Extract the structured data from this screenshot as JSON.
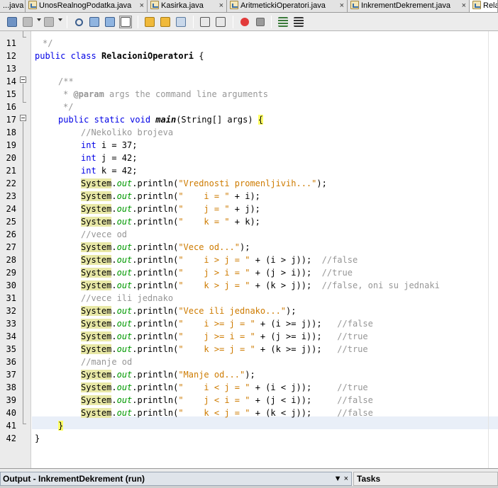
{
  "tabs": [
    {
      "label": "...java",
      "active": false
    },
    {
      "label": "UnosRealnogPodatka.java",
      "active": false
    },
    {
      "label": "Kasirka.java",
      "active": false
    },
    {
      "label": "AritmetickiOperatori.java",
      "active": false
    },
    {
      "label": "InkrementDekrement.java",
      "active": false
    },
    {
      "label": "Rela",
      "active": true
    }
  ],
  "tab_close_glyph": "×",
  "line_numbers": [
    "11",
    "12",
    "13",
    "14",
    "15",
    "16",
    "17",
    "18",
    "19",
    "20",
    "21",
    "22",
    "23",
    "24",
    "25",
    "26",
    "27",
    "28",
    "29",
    "30",
    "31",
    "32",
    "33",
    "34",
    "35",
    "36",
    "37",
    "38",
    "39",
    "40",
    "41",
    "42"
  ],
  "code": {
    "l10": "*/",
    "l11_kw1": "public",
    "l11_kw2": "class",
    "l11_name": "RelacioniOperatori",
    "l11_rest": " {",
    "l13": "/**",
    "l14_tag": "@param",
    "l14_rest": " args the command line arguments",
    "l15": "*/",
    "l16_kw": "public static void",
    "l16_name": "main",
    "l16_rest": "(String[] args) ",
    "l16_brace": "{",
    "l17": "//Nekoliko brojeva",
    "l18_kw": "int",
    "l18_rest": " i = 37;",
    "l19_kw": "int",
    "l19_rest": " j = 42;",
    "l20_kw": "int",
    "l20_rest": " k = 42;",
    "sys": "System",
    "out": "out",
    "l21_str": "\"Vrednosti promenljivih...\"",
    "l21_rest": ");",
    "l22_str": "\"    i = \"",
    "l22_rest": " + i);",
    "l23_str": "\"    j = \"",
    "l23_rest": " + j);",
    "l24_str": "\"    k = \"",
    "l24_rest": " + k);",
    "l25": "//vece od",
    "l26_str": "\"Vece od...\"",
    "l26_rest": ");",
    "l27_str": "\"    i > j = \"",
    "l27_rest": " + (i > j));  ",
    "l27_cm": "//false",
    "l28_str": "\"    j > i = \"",
    "l28_rest": " + (j > i));  ",
    "l28_cm": "//true",
    "l29_str": "\"    k > j = \"",
    "l29_rest": " + (k > j));  ",
    "l29_cm": "//false, oni su jednaki",
    "l30": "//vece ili jednako",
    "l31_str": "\"Vece ili jednako...\"",
    "l31_rest": ");",
    "l32_str": "\"    i >= j = \"",
    "l32_rest": " + (i >= j));   ",
    "l32_cm": "//false",
    "l33_str": "\"    j >= i = \"",
    "l33_rest": " + (j >= i));   ",
    "l33_cm": "//true",
    "l34_str": "\"    k >= j = \"",
    "l34_rest": " + (k >= j));   ",
    "l34_cm": "//true",
    "l35": "//manje od",
    "l36_str": "\"Manje od...\"",
    "l36_rest": ");",
    "l37_str": "\"    i < j = \"",
    "l37_rest": " + (i < j));     ",
    "l37_cm": "//true",
    "l38_str": "\"    j < i = \"",
    "l38_rest": " + (j < i));     ",
    "l38_cm": "//false",
    "l39_str": "\"    k < j = \"",
    "l39_rest": " + (k < j));     ",
    "l39_cm": "//false",
    "l40": "}",
    "l41": "}",
    "println": ".println("
  },
  "bottom": {
    "output_label": "Output - InkrementDekrement (run)",
    "output_controls": "▼ ×",
    "tasks_label": "Tasks"
  },
  "colors": {
    "keyword": "#0000e6",
    "comment": "#969696",
    "string": "#ce7b00",
    "highlight": "#e8e8a6",
    "static_field": "#009900"
  }
}
